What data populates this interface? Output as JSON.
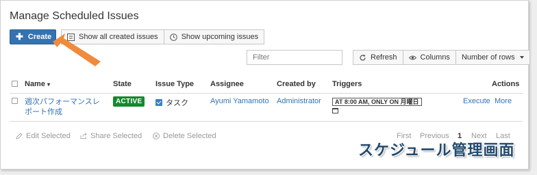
{
  "page": {
    "title": "Manage Scheduled Issues"
  },
  "toolbar": {
    "create_label": "Create",
    "show_all_label": "Show all created issues",
    "show_upcoming_label": "Show upcoming issues"
  },
  "filter": {
    "placeholder": "Filter",
    "value": ""
  },
  "table_tools": {
    "refresh_label": "Refresh",
    "columns_label": "Columns",
    "rows_label": "Number of rows"
  },
  "table": {
    "headers": {
      "name": "Name",
      "state": "State",
      "issue_type": "Issue Type",
      "assignee": "Assignee",
      "created_by": "Created by",
      "triggers": "Triggers",
      "actions": "Actions"
    },
    "rows": [
      {
        "name_line1": "週次パフォーマンスレ",
        "name_line2": "ポート作成",
        "state": "ACTIVE",
        "issue_type": "タスク",
        "assignee": "Ayumi Yamamoto",
        "created_by": "Administrator",
        "trigger": "AT 8:00 AM, ONLY ON 月曜日",
        "execute_label": "Execute",
        "more_label": "More"
      }
    ]
  },
  "bulk_actions": {
    "edit_label": "Edit Selected",
    "share_label": "Share Selected",
    "delete_label": "Delete Selected"
  },
  "pagination": {
    "first_label": "First",
    "previous_label": "Previous",
    "current_page": "1",
    "next_label": "Next",
    "last_label": "Last"
  },
  "annotation": {
    "text": "スケジュール管理画面"
  },
  "colors": {
    "primary": "#3572b0",
    "active_badge": "#14892c",
    "arrow": "#f08a3c"
  },
  "icons": {
    "create": "plus-icon",
    "show_all": "list-icon",
    "show_upcoming": "clock-icon",
    "refresh": "refresh-icon",
    "columns": "eye-icon",
    "rows": "chevron-down-icon",
    "edit": "pencil-icon",
    "share": "share-icon",
    "delete": "delete-icon"
  }
}
